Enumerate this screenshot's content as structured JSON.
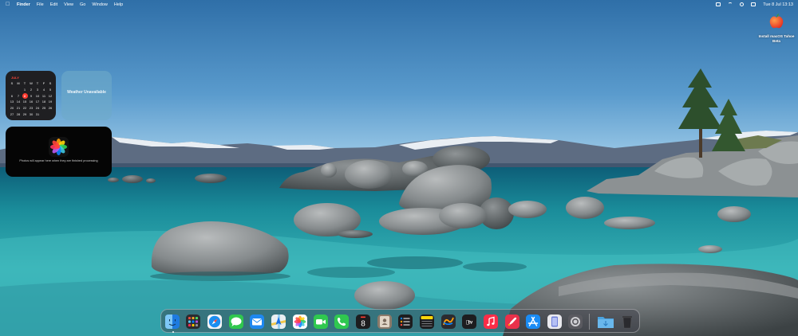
{
  "menubar": {
    "app_name": "Finder",
    "menus": [
      "File",
      "Edit",
      "View",
      "Go",
      "Window",
      "Help"
    ],
    "clock": "Tue 8 Jul  13:13"
  },
  "desktop_icons": [
    {
      "label": "Install macOS Tahoe Beta",
      "icon": "apple-installer-icon"
    }
  ],
  "widgets": {
    "calendar": {
      "month": "JULY",
      "weekday_headers": [
        "S",
        "M",
        "T",
        "W",
        "T",
        "F",
        "S"
      ],
      "weeks": [
        [
          "",
          "",
          "1",
          "2",
          "3",
          "4",
          "5"
        ],
        [
          "6",
          "7",
          "8",
          "9",
          "10",
          "11",
          "12"
        ],
        [
          "13",
          "14",
          "15",
          "16",
          "17",
          "18",
          "19"
        ],
        [
          "20",
          "21",
          "22",
          "23",
          "24",
          "25",
          "26"
        ],
        [
          "27",
          "28",
          "29",
          "30",
          "31",
          "",
          ""
        ]
      ],
      "today": "8"
    },
    "weather": {
      "message": "Weather Unavailable"
    },
    "photos": {
      "message": "Photos will appear here when they are finished processing"
    }
  },
  "dock": {
    "apps": [
      {
        "name": "Finder",
        "icon": "finder-icon",
        "running": true
      },
      {
        "name": "Launchpad",
        "icon": "launchpad-icon"
      },
      {
        "name": "Safari",
        "icon": "safari-icon"
      },
      {
        "name": "Messages",
        "icon": "messages-icon"
      },
      {
        "name": "Mail",
        "icon": "mail-icon"
      },
      {
        "name": "Maps",
        "icon": "maps-icon"
      },
      {
        "name": "Photos",
        "icon": "photos-icon"
      },
      {
        "name": "FaceTime",
        "icon": "facetime-icon"
      },
      {
        "name": "Phone",
        "icon": "phone-icon"
      },
      {
        "name": "Calendar",
        "icon": "calendar-icon",
        "text": "8"
      },
      {
        "name": "Contacts",
        "icon": "contacts-icon"
      },
      {
        "name": "Reminders",
        "icon": "reminders-icon"
      },
      {
        "name": "Notes",
        "icon": "notes-icon"
      },
      {
        "name": "Freeform",
        "icon": "freeform-icon"
      },
      {
        "name": "TV",
        "icon": "appletv-icon",
        "text": "tv"
      },
      {
        "name": "Music",
        "icon": "music-icon"
      },
      {
        "name": "Games",
        "icon": "games-icon"
      },
      {
        "name": "App Store",
        "icon": "appstore-icon"
      },
      {
        "name": "iPhone Mirroring",
        "icon": "iphone-mirroring-icon"
      },
      {
        "name": "System Settings",
        "icon": "settings-icon"
      }
    ],
    "folders": [
      {
        "name": "Downloads",
        "icon": "downloads-folder-icon"
      },
      {
        "name": "Trash",
        "icon": "trash-icon"
      }
    ]
  },
  "colors": {
    "sky_top": "#3c7fb6",
    "sky_horizon": "#9cc8e6",
    "water_deep": "#0f6f80",
    "water_shallow": "#4fc6c7",
    "calendar_accent": "#ff3b30"
  }
}
